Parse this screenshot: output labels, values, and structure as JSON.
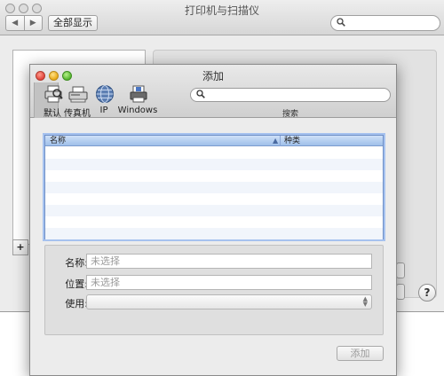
{
  "background_window": {
    "title": "打印机与扫描仪",
    "show_all_label": "全部显示",
    "nav_back": "◀",
    "nav_forward": "▶",
    "search_icon": "search-icon",
    "add_button": "+",
    "help_button": "?"
  },
  "sheet": {
    "title": "添加",
    "toolbar": [
      {
        "label": "默认",
        "icon": "default-printer-icon"
      },
      {
        "label": "传真机",
        "icon": "fax-icon"
      },
      {
        "label": "IP",
        "icon": "ip-globe-icon"
      },
      {
        "label": "Windows",
        "icon": "windows-printer-icon"
      }
    ],
    "search_label": "搜索",
    "table": {
      "columns": [
        "名称",
        "种类"
      ],
      "sort_indicator": "▲",
      "rows": []
    },
    "form": {
      "name_label": "名称:",
      "name_value": "未选择",
      "location_label": "位置:",
      "location_value": "未选择",
      "use_label": "使用:",
      "use_value": ""
    },
    "add_button_label": "添加"
  },
  "colors": {
    "selection_border": "#6f8fc6",
    "header_blue": "#9fbfe9",
    "close": "#e0443a",
    "minimize": "#e9a916",
    "maximize": "#55b52d"
  }
}
